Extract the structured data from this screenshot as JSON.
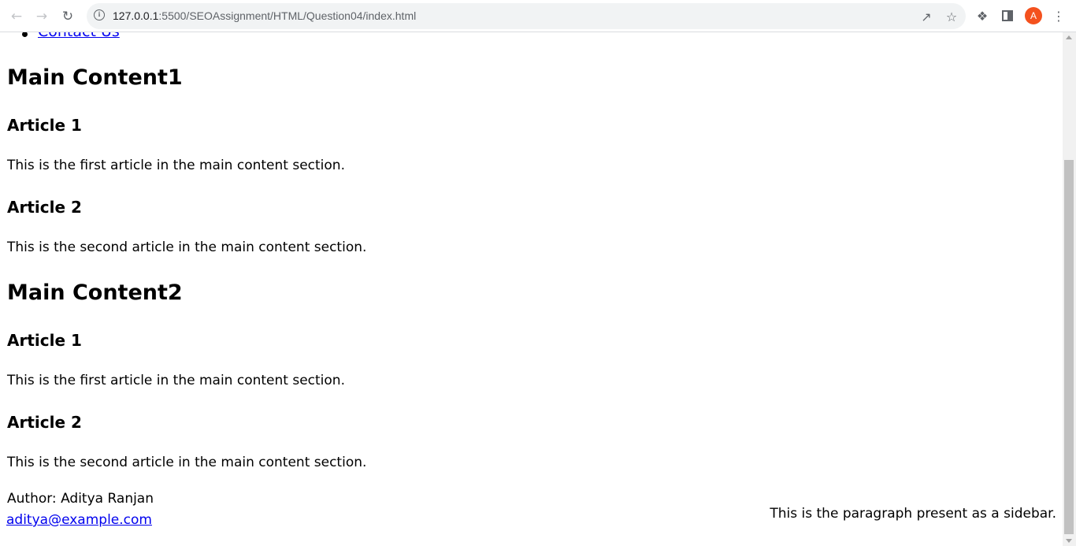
{
  "browser": {
    "url_host": "127.0.0.1",
    "url_rest": ":5500/SEOAssignment/HTML/Question04/index.html",
    "profile_initial": "A",
    "profile_color": "#f4511e"
  },
  "nav": {
    "items": [
      {
        "label": "Contact Us"
      }
    ]
  },
  "main": [
    {
      "heading": "Main Content1",
      "articles": [
        {
          "title": "Article 1",
          "text": "This is the first article in the main content section."
        },
        {
          "title": "Article 2",
          "text": "This is the second article in the main content section."
        }
      ]
    },
    {
      "heading": "Main Content2",
      "articles": [
        {
          "title": "Article 1",
          "text": "This is the first article in the main content section."
        },
        {
          "title": "Article 2",
          "text": "This is the second article in the main content section."
        }
      ]
    }
  ],
  "footer": {
    "author": "Author: Aditya Ranjan",
    "email": "aditya@example.com"
  },
  "sidebar": {
    "text": "This is the paragraph present as a sidebar."
  }
}
